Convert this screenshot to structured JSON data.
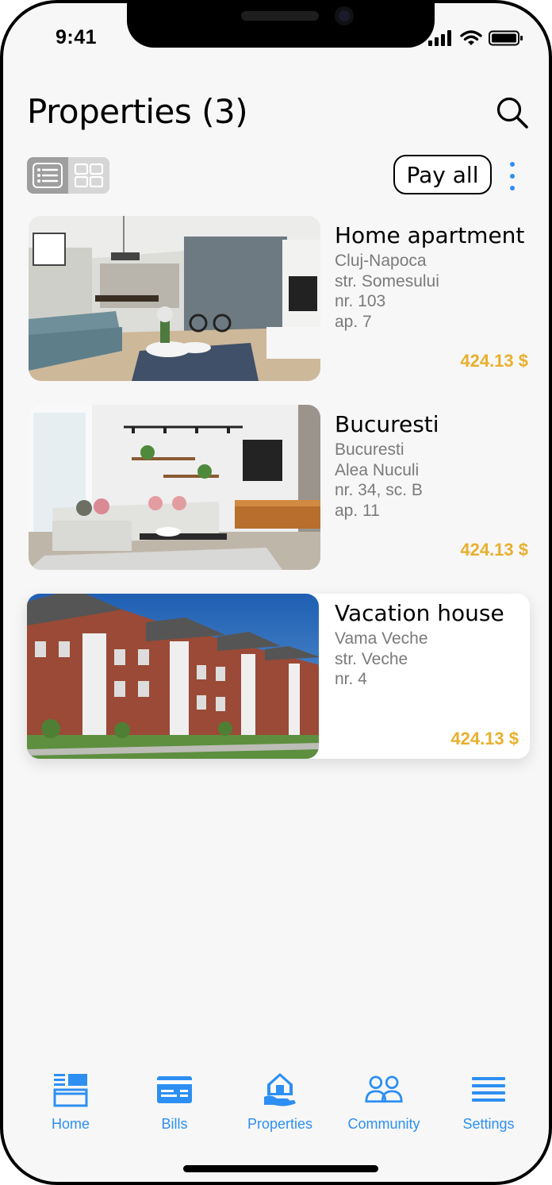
{
  "status_bar": {
    "time": "9:41"
  },
  "header": {
    "title": "Properties (3)",
    "pay_all_label": "Pay all"
  },
  "view_toggle": {
    "selected": "list",
    "options": [
      "list",
      "grid"
    ]
  },
  "properties": [
    {
      "name": "Home apartment",
      "address": [
        "Cluj-Napoca",
        "str. Somesului",
        "nr. 103",
        "ap. 7"
      ],
      "price": "424.13 $",
      "image": "living-room-photo"
    },
    {
      "name": "Bucuresti",
      "address": [
        "Bucuresti",
        "Alea Nuculi",
        "nr. 34, sc. B",
        "ap. 11"
      ],
      "price": "424.13 $",
      "image": "living-room-photo"
    },
    {
      "name": "Vacation house",
      "address": [
        "Vama Veche",
        "str. Veche",
        "nr. 4"
      ],
      "price": "424.13 $",
      "image": "apartment-building-photo"
    }
  ],
  "tabbar": {
    "items": [
      {
        "label": "Home",
        "icon": "home-icon"
      },
      {
        "label": "Bills",
        "icon": "bills-icon"
      },
      {
        "label": "Properties",
        "icon": "properties-icon",
        "active": true
      },
      {
        "label": "Community",
        "icon": "community-icon"
      },
      {
        "label": "Settings",
        "icon": "settings-icon"
      }
    ]
  },
  "colors": {
    "accent": "#2d8ff2",
    "price": "#e8b02e",
    "secondary_text": "#7a7a7a",
    "background": "#f7f7f7"
  }
}
